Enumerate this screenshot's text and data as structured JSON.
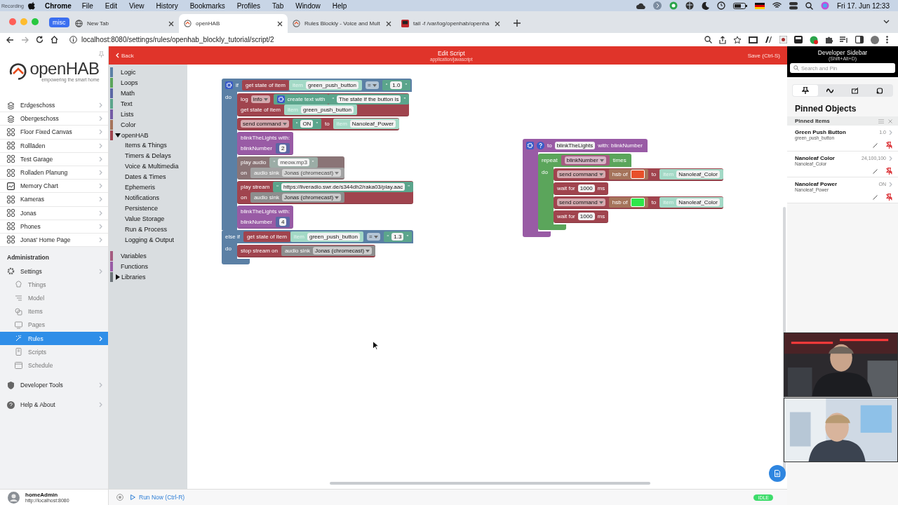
{
  "menu_bar": {
    "recording_label": "Recording",
    "app": "Chrome",
    "items": [
      "File",
      "Edit",
      "View",
      "History",
      "Bookmarks",
      "Profiles",
      "Tab",
      "Window",
      "Help"
    ],
    "clock": "Fri 17. Jun  12:33"
  },
  "browser": {
    "tab_group": "misc",
    "tabs": [
      {
        "title": "New Tab",
        "kind": "globe",
        "selected": false
      },
      {
        "title": "openHAB",
        "kind": "openhab",
        "selected": true
      },
      {
        "title": "Rules Blockly - Voice and Mult",
        "kind": "openhab",
        "selected": false
      },
      {
        "title": "tail -f /var/log/openhab/openha",
        "kind": "terminal",
        "selected": false
      }
    ],
    "url": "localhost:8080/settings/rules/openhab_blockly_tutorial/script/2"
  },
  "sidebar": {
    "logo": "openHAB",
    "tagline": "empowering the smart home",
    "pages": [
      {
        "label": "Erdgeschoss",
        "kind": "floor"
      },
      {
        "label": "Obergeschoss",
        "kind": "floor"
      },
      {
        "label": "Floor Fixed Canvas",
        "kind": "layout"
      },
      {
        "label": "Rollläden",
        "kind": "layout"
      },
      {
        "label": "Test Garage",
        "kind": "layout"
      },
      {
        "label": "Rolladen Planung",
        "kind": "layout"
      },
      {
        "label": "Memory Chart",
        "kind": "chart"
      },
      {
        "label": "Kameras",
        "kind": "layout"
      },
      {
        "label": "Jonas",
        "kind": "layout"
      },
      {
        "label": "Phones",
        "kind": "layout"
      },
      {
        "label": "Jonas' Home Page",
        "kind": "layout"
      }
    ],
    "admin_heading": "Administration",
    "settings": {
      "label": "Settings",
      "children": [
        {
          "label": "Things",
          "selected": false
        },
        {
          "label": "Model",
          "selected": false
        },
        {
          "label": "Items",
          "selected": false
        },
        {
          "label": "Pages",
          "selected": false
        },
        {
          "label": "Rules",
          "selected": true
        },
        {
          "label": "Scripts",
          "selected": false
        },
        {
          "label": "Schedule",
          "selected": false
        }
      ]
    },
    "developer_tools": "Developer Tools",
    "help": "Help & About",
    "user": {
      "name": "homeAdmin",
      "url": "http://localhost:8080"
    }
  },
  "editor": {
    "back": "Back",
    "title": "Edit Script",
    "subtitle": "application/javascript",
    "save": "Save (Ctrl-S)"
  },
  "toolbox": [
    {
      "label": "Logic",
      "color": "#5b80a5"
    },
    {
      "label": "Loops",
      "color": "#5ba55b"
    },
    {
      "label": "Math",
      "color": "#5b67a5"
    },
    {
      "label": "Text",
      "color": "#5ba58c"
    },
    {
      "label": "Lists",
      "color": "#745ba5"
    },
    {
      "label": "Color",
      "color": "#a5745b"
    },
    {
      "label": "openHAB",
      "color": "#a0444e",
      "expanded": true,
      "children": [
        "Items & Things",
        "Timers & Delays",
        "Voice & Multimedia",
        "Dates & Times",
        "Ephemeris",
        "Notifications",
        "Persistence",
        "Value Storage",
        "Run & Process",
        "Logging & Output"
      ]
    },
    {
      "label": "Variables",
      "color": "#a55b80"
    },
    {
      "label": "Functions",
      "color": "#995ba5"
    },
    {
      "label": "Libraries",
      "color": "#6d7479",
      "expanded": false
    }
  ],
  "workspace": [
    {
      "kind": "logic",
      "clauses": [
        {
          "row": [
            {
              "kind": "logic",
              "tokens": [
                {
                  "kind": "gear"
                },
                {
                  "kind": "label",
                  "text": "if"
                }
              ]
            },
            {
              "kind": "openhab",
              "tokens": [
                {
                  "kind": "label",
                  "text": "get state of item"
                }
              ]
            },
            {
              "kind": "item",
              "tokens": [
                {
                  "kind": "label",
                  "text": "item"
                },
                {
                  "kind": "field",
                  "text": "green_push_button"
                }
              ]
            },
            {
              "kind": "logic",
              "tokens": [
                {
                  "kind": "dropdown",
                  "text": "="
                }
              ]
            },
            {
              "kind": "text",
              "tokens": [
                {
                  "kind": "label",
                  "text": "“"
                },
                {
                  "kind": "field",
                  "text": "1.0"
                },
                {
                  "kind": "label",
                  "text": "”"
                }
              ]
            }
          ],
          "do": "do",
          "statements": [
            {
              "kind": "openhab",
              "disabled": false,
              "rows": [
                {
                  "segments": [
                    {
                      "kind": "openhab",
                      "tokens": [
                        {
                          "kind": "label",
                          "text": "log"
                        },
                        {
                          "kind": "dropdown",
                          "text": "info"
                        }
                      ]
                    },
                    {
                      "kind": "text",
                      "tokens": [
                        {
                          "kind": "gear"
                        },
                        {
                          "kind": "label",
                          "text": "create text with"
                        }
                      ]
                    },
                    {
                      "kind": "text",
                      "tokens": [
                        {
                          "kind": "label",
                          "text": "“"
                        },
                        {
                          "kind": "field",
                          "text": "The state if the button is"
                        },
                        {
                          "kind": "label",
                          "text": "”"
                        }
                      ]
                    }
                  ]
                },
                {
                  "segments": [
                    {
                      "kind": "openhab",
                      "tokens": [
                        {
                          "kind": "label",
                          "text": "get state of item"
                        }
                      ]
                    },
                    {
                      "kind": "item",
                      "tokens": [
                        {
                          "kind": "label",
                          "text": "item"
                        },
                        {
                          "kind": "field",
                          "text": "green_push_button"
                        }
                      ]
                    }
                  ]
                }
              ]
            },
            {
              "kind": "openhab",
              "disabled": false,
              "rows": [
                {
                  "segments": [
                    {
                      "kind": "openhab",
                      "tokens": [
                        {
                          "kind": "dropdown",
                          "text": "send command"
                        }
                      ]
                    },
                    {
                      "kind": "text",
                      "tokens": [
                        {
                          "kind": "label",
                          "text": "“"
                        },
                        {
                          "kind": "field",
                          "text": "ON"
                        },
                        {
                          "kind": "label",
                          "text": "”"
                        }
                      ]
                    },
                    {
                      "kind": "openhab",
                      "tokens": [
                        {
                          "kind": "label",
                          "text": "to"
                        }
                      ]
                    },
                    {
                      "kind": "item",
                      "tokens": [
                        {
                          "kind": "label",
                          "text": "item"
                        },
                        {
                          "kind": "field",
                          "text": "Nanoleaf_Power"
                        }
                      ]
                    }
                  ]
                }
              ]
            },
            {
              "kind": "procedure",
              "disabled": false,
              "rows": [
                {
                  "segments": [
                    {
                      "kind": "procedure",
                      "tokens": [
                        {
                          "kind": "label",
                          "text": "blinkTheLights  with:"
                        }
                      ]
                    }
                  ]
                },
                {
                  "segments": [
                    {
                      "kind": "procedure",
                      "tokens": [
                        {
                          "kind": "label",
                          "text": "blinkNumber"
                        }
                      ]
                    },
                    {
                      "kind": "math",
                      "tokens": [
                        {
                          "kind": "field",
                          "text": "2"
                        }
                      ]
                    }
                  ]
                }
              ]
            },
            {
              "kind": "openhab",
              "disabled": true,
              "rows": [
                {
                  "segments": [
                    {
                      "kind": "openhab",
                      "tokens": [
                        {
                          "kind": "label",
                          "text": "play audio"
                        }
                      ]
                    },
                    {
                      "kind": "text",
                      "tokens": [
                        {
                          "kind": "label",
                          "text": "“"
                        },
                        {
                          "kind": "field",
                          "text": "meow.mp3"
                        },
                        {
                          "kind": "label",
                          "text": "”"
                        }
                      ]
                    }
                  ]
                },
                {
                  "segments": [
                    {
                      "kind": "openhab",
                      "tokens": [
                        {
                          "kind": "label",
                          "text": "on"
                        }
                      ]
                    },
                    {
                      "kind": "sink",
                      "tokens": [
                        {
                          "kind": "label",
                          "text": "audio sink"
                        },
                        {
                          "kind": "dropdown",
                          "text": "Jonas (chromecast)"
                        }
                      ]
                    }
                  ]
                }
              ]
            },
            {
              "kind": "openhab",
              "disabled": false,
              "rows": [
                {
                  "segments": [
                    {
                      "kind": "openhab",
                      "tokens": [
                        {
                          "kind": "label",
                          "text": "play stream"
                        }
                      ]
                    },
                    {
                      "kind": "text",
                      "tokens": [
                        {
                          "kind": "label",
                          "text": "“"
                        },
                        {
                          "kind": "field",
                          "text": "https://liveradio.swr.de/s344dh2/raka03/play.aac"
                        },
                        {
                          "kind": "label",
                          "text": "”"
                        }
                      ]
                    }
                  ]
                },
                {
                  "segments": [
                    {
                      "kind": "openhab",
                      "tokens": [
                        {
                          "kind": "label",
                          "text": "on"
                        }
                      ]
                    },
                    {
                      "kind": "sink",
                      "tokens": [
                        {
                          "kind": "label",
                          "text": "audio sink"
                        },
                        {
                          "kind": "dropdown",
                          "text": "Jonas (chromecast)"
                        }
                      ]
                    }
                  ]
                }
              ]
            },
            {
              "kind": "procedure",
              "disabled": false,
              "rows": [
                {
                  "segments": [
                    {
                      "kind": "procedure",
                      "tokens": [
                        {
                          "kind": "label",
                          "text": "blinkTheLights  with:"
                        }
                      ]
                    }
                  ]
                },
                {
                  "segments": [
                    {
                      "kind": "procedure",
                      "tokens": [
                        {
                          "kind": "label",
                          "text": "blinkNumber"
                        }
                      ]
                    },
                    {
                      "kind": "math",
                      "tokens": [
                        {
                          "kind": "field",
                          "text": "4"
                        }
                      ]
                    }
                  ]
                }
              ]
            }
          ]
        },
        {
          "row": [
            {
              "kind": "logic",
              "tokens": [
                {
                  "kind": "label",
                  "text": "else if"
                }
              ]
            },
            {
              "kind": "openhab",
              "tokens": [
                {
                  "kind": "label",
                  "text": "get state of item"
                }
              ]
            },
            {
              "kind": "item",
              "tokens": [
                {
                  "kind": "label",
                  "text": "item"
                },
                {
                  "kind": "field",
                  "text": "green_push_button"
                }
              ]
            },
            {
              "kind": "logic",
              "tokens": [
                {
                  "kind": "dropdown",
                  "text": "="
                }
              ]
            },
            {
              "kind": "text",
              "tokens": [
                {
                  "kind": "label",
                  "text": "“"
                },
                {
                  "kind": "field",
                  "text": "1.3"
                },
                {
                  "kind": "label",
                  "text": "”"
                }
              ]
            }
          ],
          "do": "do",
          "statements": [
            {
              "kind": "openhab",
              "rows": [
                {
                  "segments": [
                    {
                      "kind": "openhab",
                      "tokens": [
                        {
                          "kind": "label",
                          "text": "stop stream on"
                        }
                      ]
                    },
                    {
                      "kind": "sink",
                      "tokens": [
                        {
                          "kind": "label",
                          "text": "audio sink"
                        },
                        {
                          "kind": "dropdown",
                          "text": "Jonas (chromecast)"
                        }
                      ]
                    }
                  ]
                }
              ]
            }
          ]
        }
      ]
    },
    {
      "kind": "procedure",
      "clauses": [
        {
          "row": [
            {
              "kind": "procedure",
              "tokens": [
                {
                  "kind": "gear"
                },
                {
                  "kind": "help"
                },
                {
                  "kind": "label",
                  "text": "to"
                },
                {
                  "kind": "field",
                  "text": "blinkTheLights"
                },
                {
                  "kind": "label",
                  "text": "with: blinkNumber"
                }
              ]
            }
          ],
          "statements": [
            {
              "kind": "loops",
              "clauses": [
                {
                  "row": [
                    {
                      "kind": "loops",
                      "tokens": [
                        {
                          "kind": "label",
                          "text": "repeat"
                        }
                      ]
                    },
                    {
                      "kind": "variable",
                      "tokens": [
                        {
                          "kind": "dropdown",
                          "text": "blinkNumber"
                        }
                      ]
                    },
                    {
                      "kind": "loops",
                      "tokens": [
                        {
                          "kind": "label",
                          "text": "times"
                        }
                      ]
                    }
                  ],
                  "do": "do",
                  "statements": [
                    {
                      "kind": "openhab",
                      "rows": [
                        {
                          "segments": [
                            {
                              "kind": "openhab",
                              "tokens": [
                                {
                                  "kind": "dropdown",
                                  "text": "send command"
                                }
                              ]
                            },
                            {
                              "kind": "color",
                              "tokens": [
                                {
                                  "kind": "label",
                                  "text": "hsb of"
                                },
                                {
                                  "kind": "swatch",
                                  "color": "#e8502a"
                                }
                              ]
                            },
                            {
                              "kind": "openhab",
                              "tokens": [
                                {
                                  "kind": "label",
                                  "text": "to"
                                }
                              ]
                            },
                            {
                              "kind": "item",
                              "tokens": [
                                {
                                  "kind": "label",
                                  "text": "item"
                                },
                                {
                                  "kind": "field",
                                  "text": "Nanoleaf_Color"
                                }
                              ]
                            }
                          ]
                        }
                      ]
                    },
                    {
                      "kind": "openhab",
                      "rows": [
                        {
                          "segments": [
                            {
                              "kind": "openhab",
                              "tokens": [
                                {
                                  "kind": "label",
                                  "text": "wait for"
                                },
                                {
                                  "kind": "field",
                                  "text": "1000"
                                },
                                {
                                  "kind": "label",
                                  "text": "ms"
                                }
                              ]
                            }
                          ]
                        }
                      ]
                    },
                    {
                      "kind": "openhab",
                      "rows": [
                        {
                          "segments": [
                            {
                              "kind": "openhab",
                              "tokens": [
                                {
                                  "kind": "dropdown",
                                  "text": "send command"
                                }
                              ]
                            },
                            {
                              "kind": "color",
                              "tokens": [
                                {
                                  "kind": "label",
                                  "text": "hsb of"
                                },
                                {
                                  "kind": "swatch",
                                  "color": "#2ee64a"
                                }
                              ]
                            },
                            {
                              "kind": "openhab",
                              "tokens": [
                                {
                                  "kind": "label",
                                  "text": "to"
                                }
                              ]
                            },
                            {
                              "kind": "item",
                              "tokens": [
                                {
                                  "kind": "label",
                                  "text": "item"
                                },
                                {
                                  "kind": "field",
                                  "text": "Nanoleaf_Color"
                                }
                              ]
                            }
                          ]
                        }
                      ]
                    },
                    {
                      "kind": "openhab",
                      "rows": [
                        {
                          "segments": [
                            {
                              "kind": "openhab",
                              "tokens": [
                                {
                                  "kind": "label",
                                  "text": "wait for"
                                },
                                {
                                  "kind": "field",
                                  "text": "1000"
                                },
                                {
                                  "kind": "label",
                                  "text": "ms"
                                }
                              ]
                            }
                          ]
                        }
                      ]
                    }
                  ]
                }
              ]
            }
          ]
        }
      ]
    }
  ],
  "footer": {
    "run": "Run Now (Ctrl-R)",
    "status": "IDLE"
  },
  "dev_sidebar": {
    "title": "Developer Sidebar",
    "shortcut": "(Shift+Alt+D)",
    "search": {
      "placeholder": "Search and Pin"
    },
    "tabs": [
      {
        "selected": true
      },
      {
        "selected": false
      },
      {
        "selected": false
      },
      {
        "selected": false
      }
    ],
    "heading": "Pinned Objects",
    "subheading": "Pinned Items",
    "items": [
      {
        "label": "Green Push Button",
        "name": "green_push_button",
        "state": "1.0"
      },
      {
        "label": "Nanoleaf Color",
        "name": "Nanoleaf_Color",
        "state": "24,100,100"
      },
      {
        "label": "Nanoleaf Power",
        "name": "Nanoleaf_Power",
        "state": "ON"
      }
    ]
  }
}
